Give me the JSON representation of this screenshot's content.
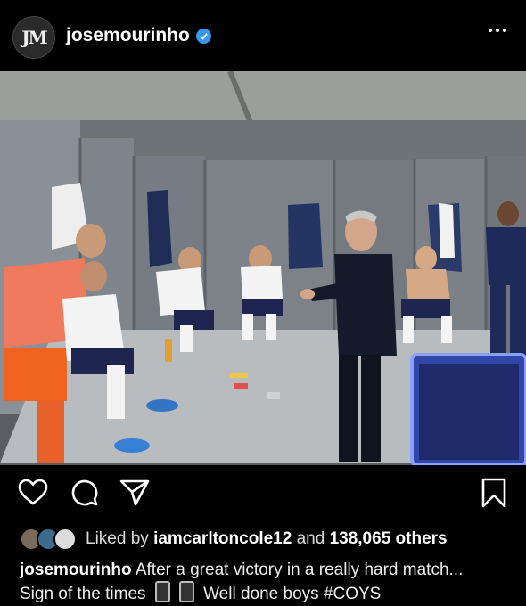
{
  "post": {
    "username": "josemourinho",
    "avatar_initials": "JM",
    "verified": true,
    "liked_by_prefix": "Liked by",
    "liked_by_user": "iamcarltoncole12",
    "liked_by_and": "and",
    "liked_by_others": "138,065 others",
    "caption_user": "josemourinho",
    "caption_line1": "After a great victory in a really hard match...",
    "caption_line2a": "Sign of the times",
    "caption_line2b": "Well done boys #COYS"
  },
  "icons": {
    "like": "heart-icon",
    "comment": "comment-icon",
    "share": "send-icon",
    "save": "bookmark-icon",
    "more": "more-icon",
    "verified": "verified-badge-icon"
  },
  "colors": {
    "background": "#000000",
    "verified": "#3897f0"
  }
}
